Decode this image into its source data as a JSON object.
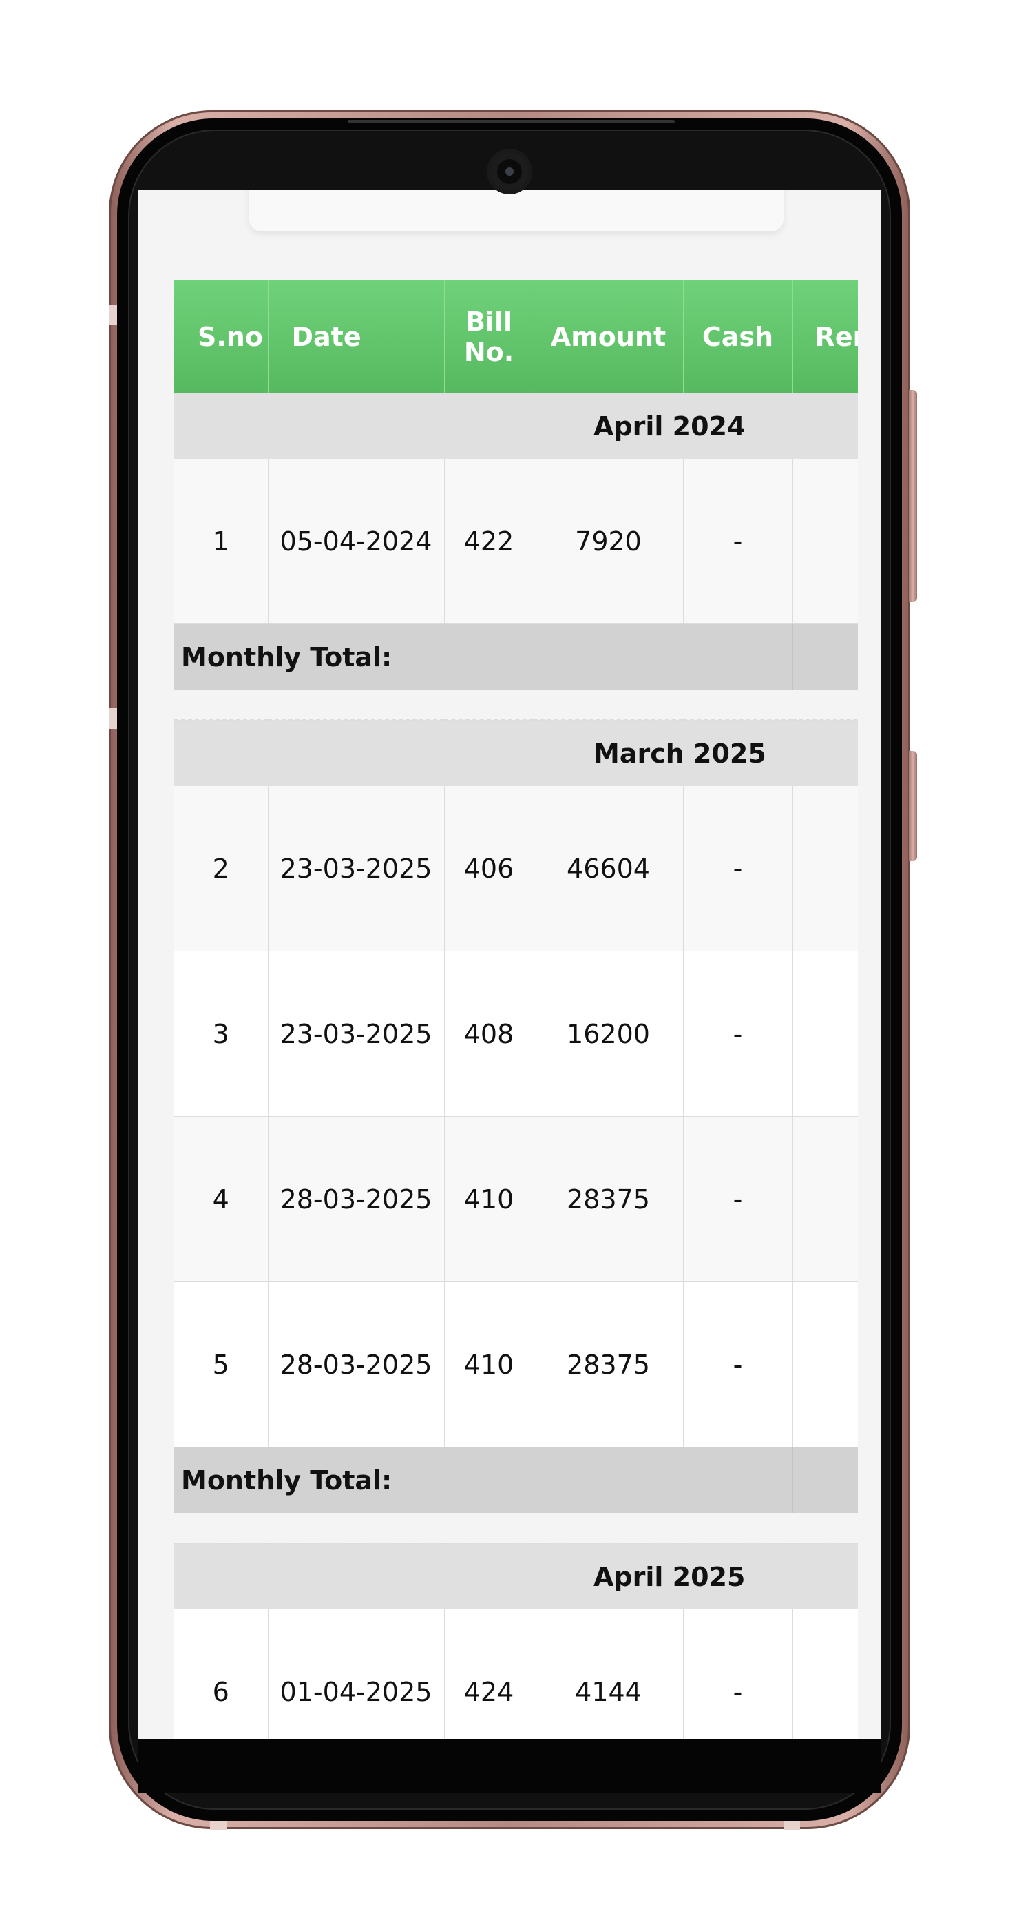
{
  "table": {
    "headers": [
      "S.no",
      "Date",
      "Bill No.",
      "Amount",
      "Cash",
      "Rem"
    ],
    "header_bill_line1": "Bill",
    "header_bill_line2": "No.",
    "groups": [
      {
        "month": "April 2024",
        "rows": [
          {
            "sno": "1",
            "date": "05-04-2024",
            "bill": "422",
            "amount": "7920",
            "cash": "-",
            "rem": ""
          }
        ],
        "total_label": "Monthly Total:"
      },
      {
        "month": "March 2025",
        "rows": [
          {
            "sno": "2",
            "date": "23-03-2025",
            "bill": "406",
            "amount": "46604",
            "cash": "-",
            "rem": ""
          },
          {
            "sno": "3",
            "date": "23-03-2025",
            "bill": "408",
            "amount": "16200",
            "cash": "-",
            "rem": ""
          },
          {
            "sno": "4",
            "date": "28-03-2025",
            "bill": "410",
            "amount": "28375",
            "cash": "-",
            "rem": ""
          },
          {
            "sno": "5",
            "date": "28-03-2025",
            "bill": "410",
            "amount": "28375",
            "cash": "-",
            "rem": ""
          }
        ],
        "total_label": "Monthly Total:"
      },
      {
        "month": "April 2025",
        "rows": [
          {
            "sno": "6",
            "date": "01-04-2025",
            "bill": "424",
            "amount": "4144",
            "cash": "-",
            "rem": ""
          }
        ]
      }
    ]
  },
  "colors": {
    "header_green": "#5fc468",
    "month_row": "#e0e0e0",
    "total_row": "#d2d2d2",
    "phone_frame": "#b48a82"
  }
}
